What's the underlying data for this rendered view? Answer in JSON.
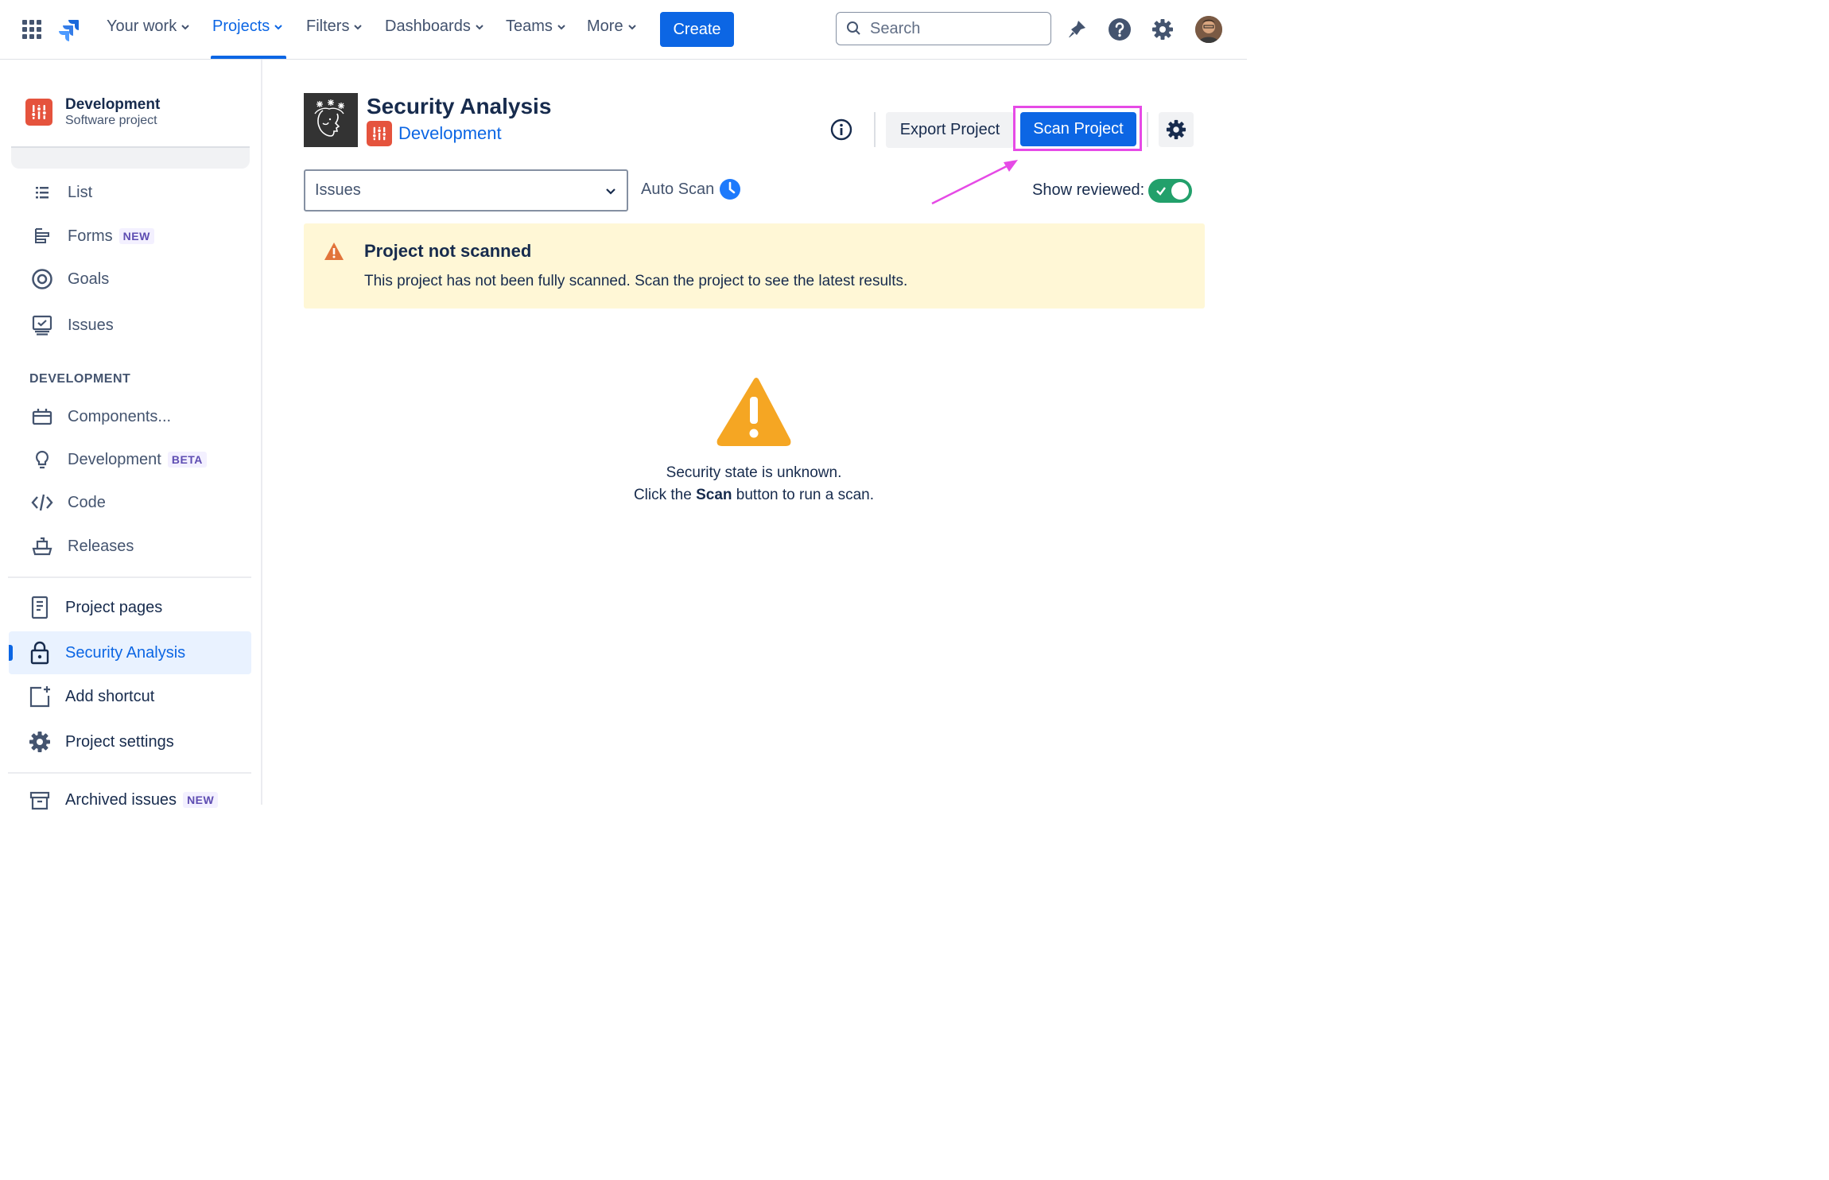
{
  "topnav": {
    "items": [
      {
        "label": "Your work"
      },
      {
        "label": "Projects"
      },
      {
        "label": "Filters"
      },
      {
        "label": "Dashboards"
      },
      {
        "label": "Teams"
      },
      {
        "label": "More"
      }
    ],
    "active_item": "Projects",
    "create_label": "Create",
    "search_placeholder": "Search"
  },
  "sidebar": {
    "project_name": "Development",
    "project_type": "Software project",
    "items": [
      {
        "label": "List",
        "icon": "list-icon"
      },
      {
        "label": "Forms",
        "badge": "NEW",
        "icon": "forms-icon"
      },
      {
        "label": "Goals",
        "icon": "goals-icon"
      },
      {
        "label": "Issues",
        "icon": "issues-icon"
      }
    ],
    "section_label": "DEVELOPMENT",
    "dev_items": [
      {
        "label": "Components...",
        "icon": "components-icon"
      },
      {
        "label": "Development",
        "badge": "BETA",
        "icon": "lightbulb-icon"
      },
      {
        "label": "Code",
        "icon": "code-icon"
      },
      {
        "label": "Releases",
        "icon": "ship-icon"
      }
    ],
    "bottom_items": [
      {
        "label": "Project pages",
        "icon": "page-icon"
      },
      {
        "label": "Security Analysis",
        "icon": "lock-icon",
        "selected": true
      },
      {
        "label": "Add shortcut",
        "icon": "add-shortcut-icon"
      },
      {
        "label": "Project settings",
        "icon": "gear-icon"
      },
      {
        "label": "Archived issues",
        "badge": "NEW",
        "icon": "archive-icon"
      }
    ]
  },
  "main": {
    "title": "Security Analysis",
    "project_link": "Development",
    "export_label": "Export Project",
    "scan_label": "Scan Project",
    "filter_select": {
      "value": "Issues"
    },
    "auto_scan_label": "Auto Scan",
    "show_reviewed_label": "Show reviewed:",
    "show_reviewed_on": true,
    "banner": {
      "title": "Project not scanned",
      "text": "This project has not been fully scanned. Scan the project to see the latest results."
    },
    "empty_state": {
      "line1": "Security state is unknown.",
      "line2_pre": "Click the ",
      "line2_bold": "Scan",
      "line2_post": " button to run a scan."
    }
  },
  "colors": {
    "primary": "#0c66e4",
    "highlight": "#e64ae6",
    "warning": "#f5a623",
    "banner_bg": "#fff7d6",
    "toggle_on": "#22a06b",
    "project_icon": "#e5533d"
  }
}
